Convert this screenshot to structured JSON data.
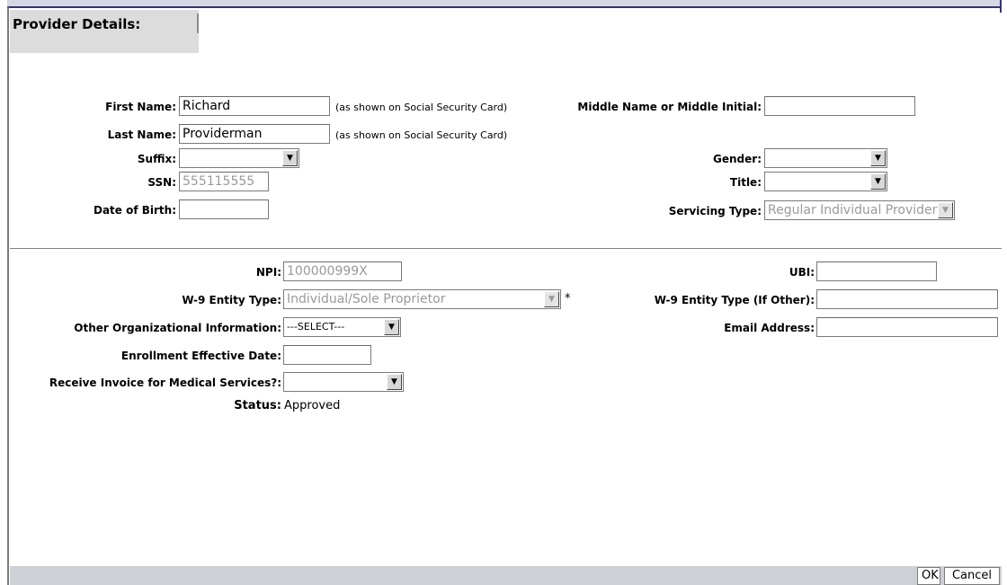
{
  "page": {
    "title": "Provider Details:"
  },
  "person": {
    "first_name": {
      "label": "First Name:",
      "value": "Richard",
      "note": "(as shown on Social Security Card)"
    },
    "middle_name": {
      "label": "Middle Name or Middle Initial:",
      "value": ""
    },
    "last_name": {
      "label": "Last Name:",
      "value": "Providerman",
      "note": "(as shown on Social Security Card)"
    },
    "suffix": {
      "label": "Suffix:",
      "value": ""
    },
    "gender": {
      "label": "Gender:",
      "value": ""
    },
    "ssn": {
      "label": "SSN:",
      "value": "555115555"
    },
    "title": {
      "label": "Title:",
      "value": ""
    },
    "dob": {
      "label": "Date of Birth:",
      "value": ""
    },
    "servicing_type": {
      "label": "Servicing Type:",
      "value": "Regular Individual Provider"
    }
  },
  "org": {
    "npi": {
      "label": "NPI:",
      "value": "100000999X"
    },
    "ubi": {
      "label": "UBI:",
      "value": ""
    },
    "w9_entity_type": {
      "label": "W-9 Entity Type:",
      "value": "Individual/Sole Proprietor",
      "required_mark": "*"
    },
    "w9_entity_type_other": {
      "label": "W-9 Entity Type (If Other):",
      "value": ""
    },
    "other_org_info": {
      "label": "Other Organizational Information:",
      "value": "---SELECT---"
    },
    "email": {
      "label": "Email Address:",
      "value": ""
    },
    "enrollment_date": {
      "label": "Enrollment Effective Date:",
      "value": ""
    },
    "receive_invoice": {
      "label": "Receive Invoice for Medical Services?:",
      "value": ""
    },
    "status": {
      "label": "Status:",
      "value": "Approved"
    }
  },
  "buttons": {
    "ok": "OK",
    "cancel": "Cancel"
  },
  "icons": {
    "dropdown": "chevron-down-icon"
  }
}
